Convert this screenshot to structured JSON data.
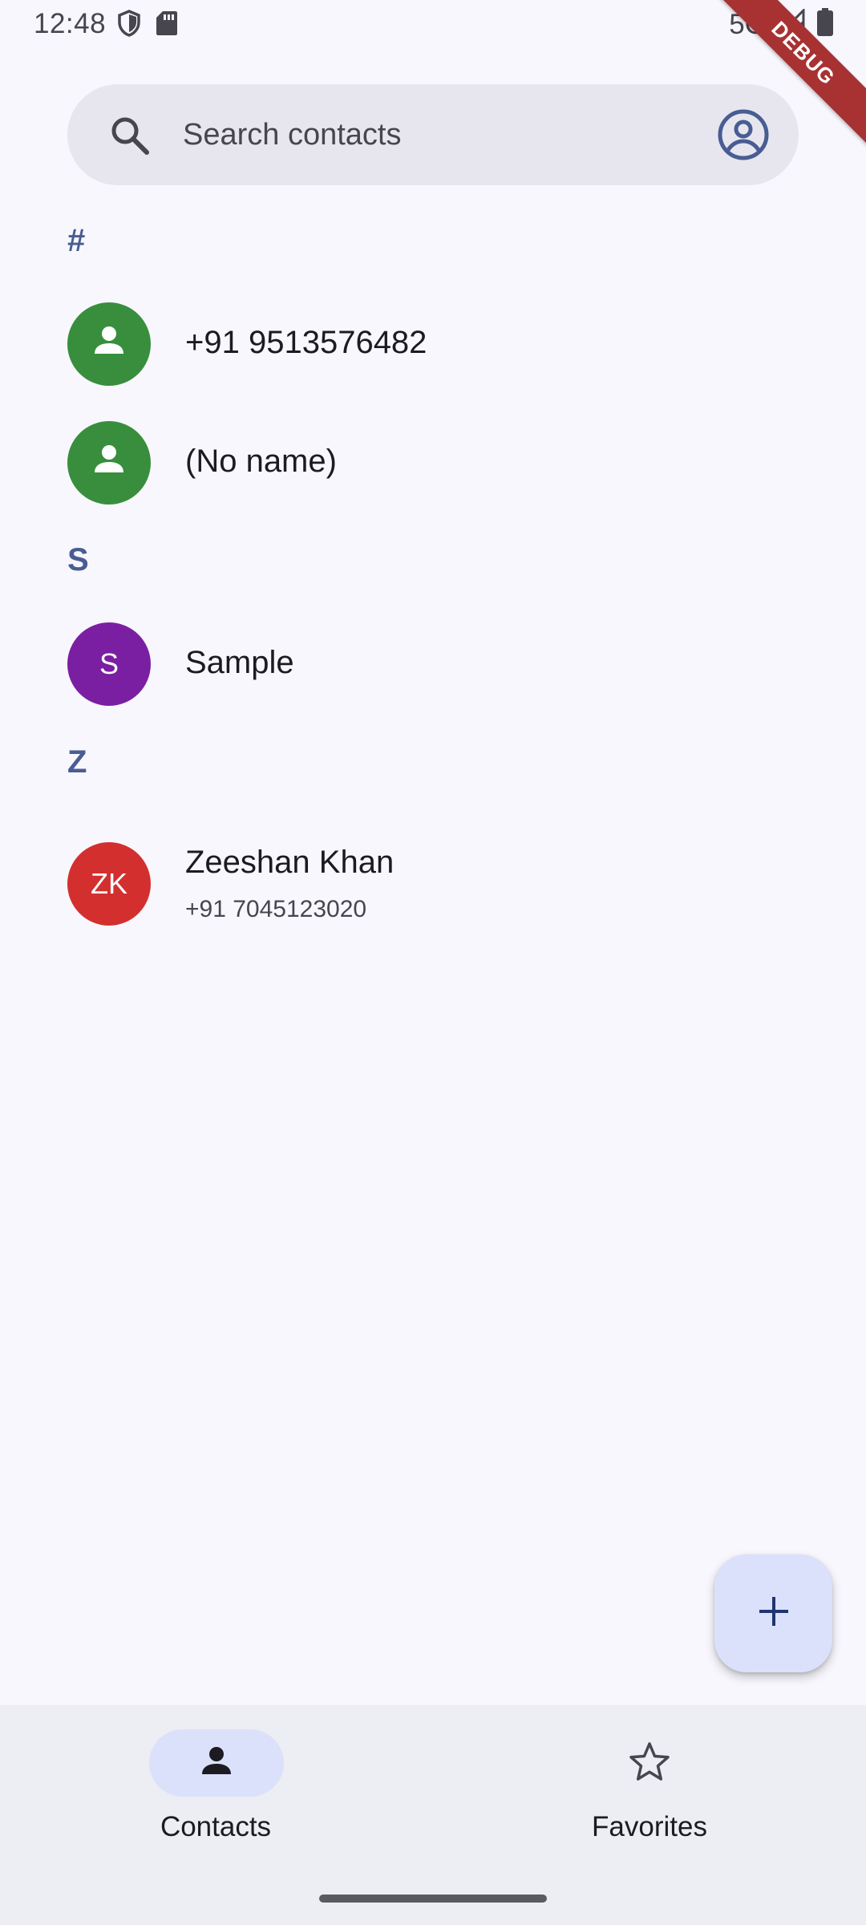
{
  "status_bar": {
    "time": "12:48",
    "network": "5G",
    "left_icons": [
      "shield-icon",
      "sd-card-icon"
    ],
    "right_icons": [
      "signal-icon",
      "battery-icon"
    ]
  },
  "debug_banner": "DEBUG",
  "search": {
    "placeholder": "Search contacts",
    "value": "",
    "left_icon": "search-icon",
    "right_icon": "account-circle-icon"
  },
  "sections": [
    {
      "header": "#",
      "contacts": [
        {
          "name": "+91 9513576482",
          "avatar_text": "",
          "avatar_icon": "person-icon",
          "avatar_color": "#388e3c"
        },
        {
          "name": "(No name)",
          "avatar_text": "",
          "avatar_icon": "person-icon",
          "avatar_color": "#388e3c"
        }
      ]
    },
    {
      "header": "S",
      "contacts": [
        {
          "name": "Sample",
          "avatar_text": "S",
          "avatar_color": "#7b1fa2"
        }
      ]
    },
    {
      "header": "Z",
      "contacts": [
        {
          "name": "Zeeshan Khan",
          "subtitle": "+91 7045123020",
          "avatar_text": "ZK",
          "avatar_color": "#d32f2f"
        }
      ]
    }
  ],
  "fab": {
    "icon": "add-icon"
  },
  "bottom_nav": {
    "items": [
      {
        "label": "Contacts",
        "icon": "person-icon",
        "selected": true
      },
      {
        "label": "Favorites",
        "icon": "star-outline-icon",
        "selected": false
      }
    ]
  },
  "colors": {
    "background": "#f8f7fd",
    "accent": "#485d92",
    "search_bg": "#e7e6ef",
    "nav_bg": "#ededf4",
    "nav_indicator": "#dbe1fb",
    "fab_bg": "#dbe1fb",
    "debug_banner": "#a83232"
  }
}
